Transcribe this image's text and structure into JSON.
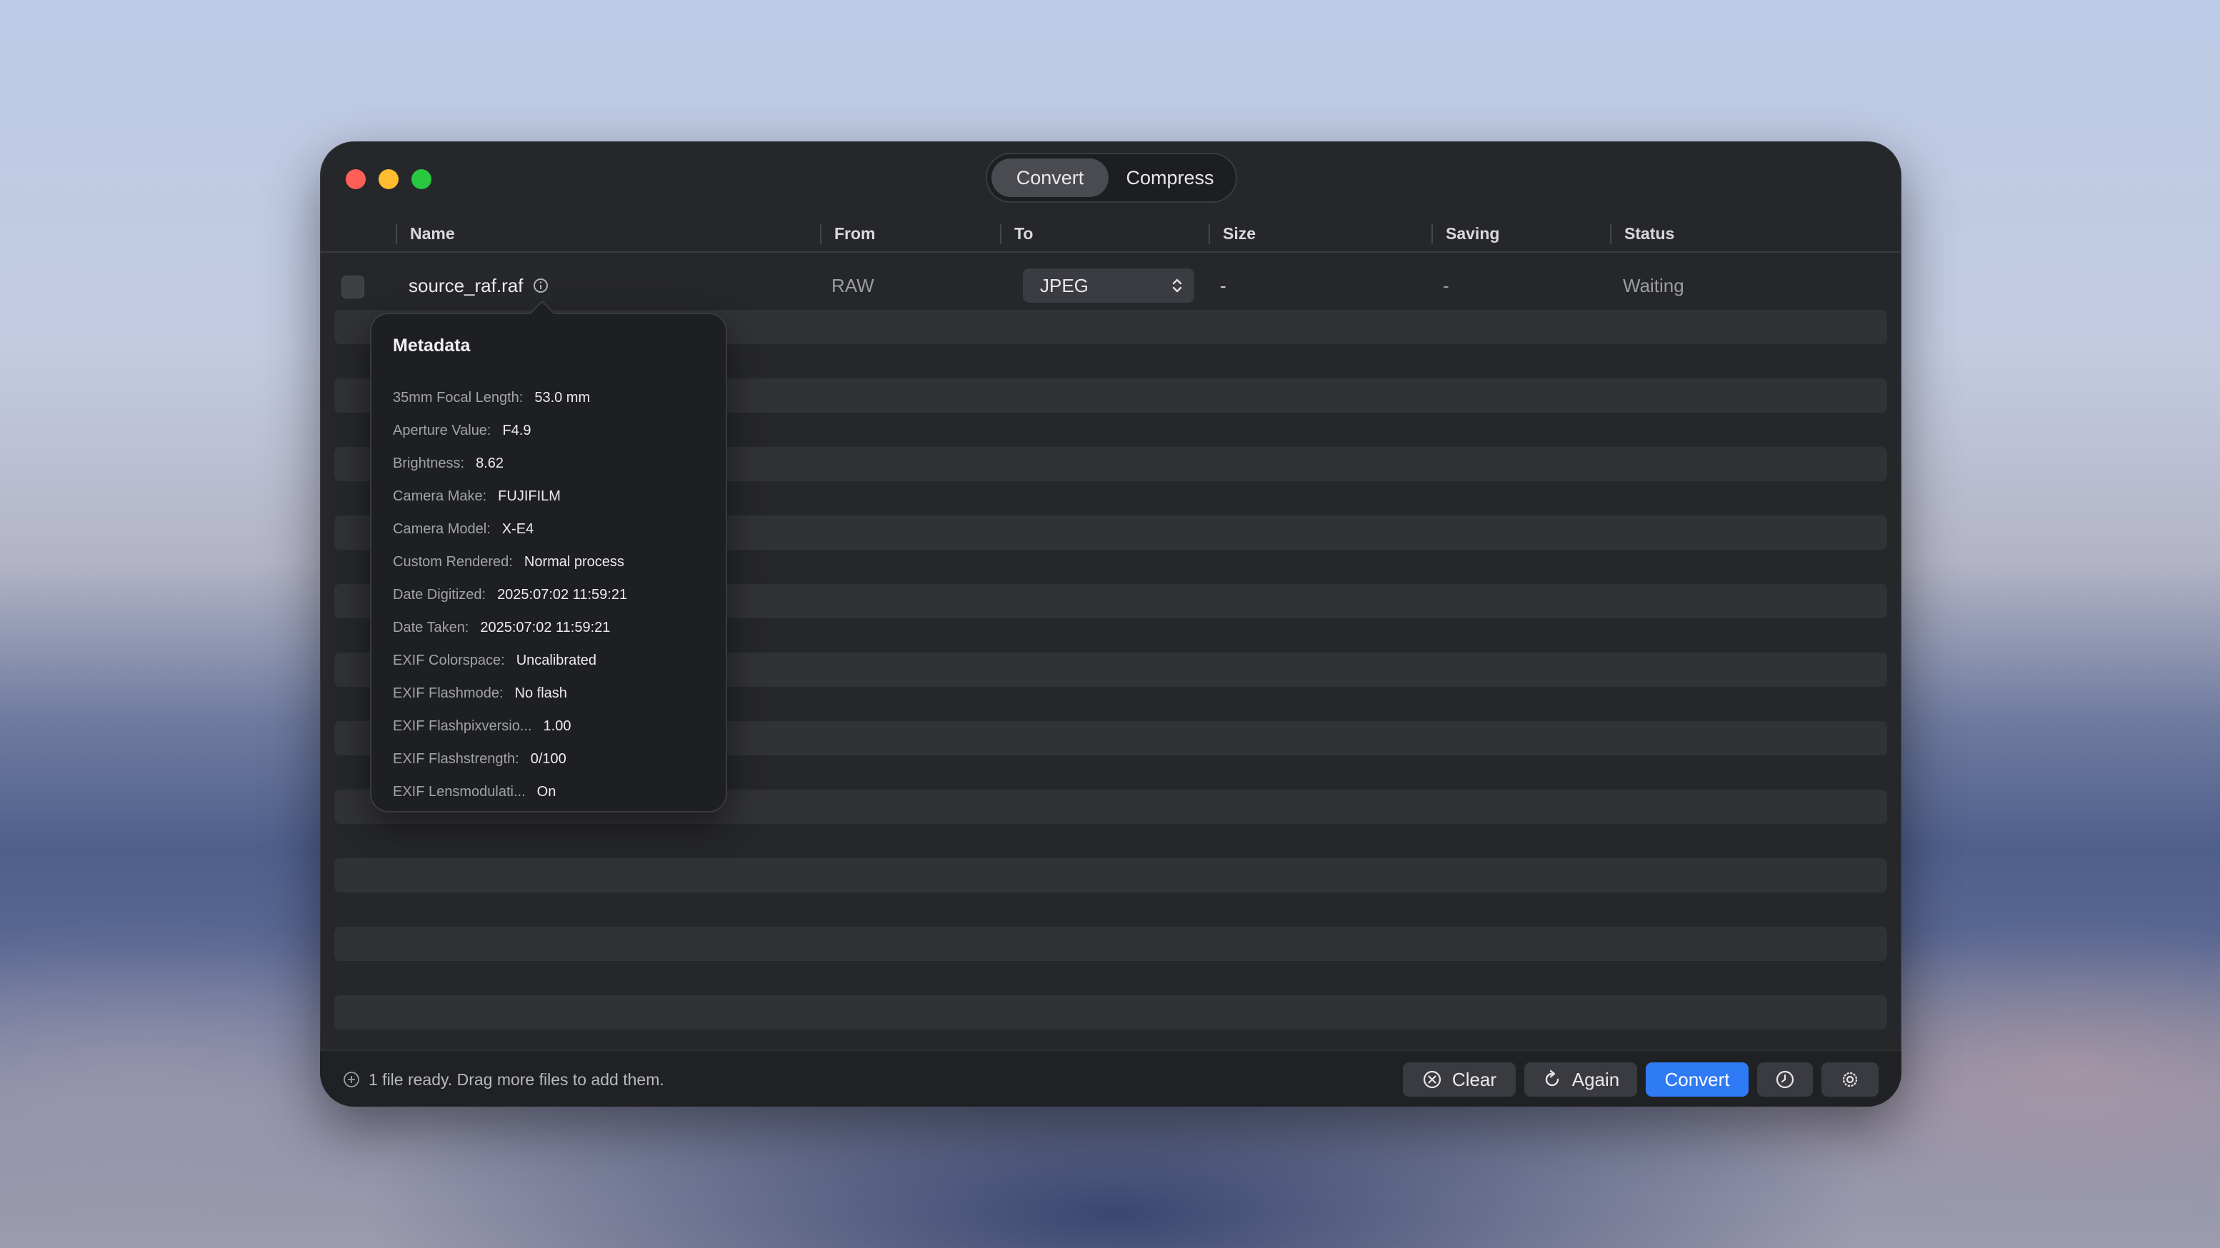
{
  "tabs": [
    {
      "label": "Convert",
      "active": true
    },
    {
      "label": "Compress",
      "active": false
    }
  ],
  "columns": {
    "name": "Name",
    "from": "From",
    "to": "To",
    "size": "Size",
    "saving": "Saving",
    "status": "Status"
  },
  "file": {
    "name": "source_raf.raf",
    "from": "RAW",
    "to": "JPEG",
    "size": "-",
    "saving": "-",
    "status": "Waiting"
  },
  "metadata": {
    "title": "Metadata",
    "rows": [
      {
        "label": "35mm Focal Length:",
        "value": "53.0 mm"
      },
      {
        "label": "Aperture Value:",
        "value": "F4.9"
      },
      {
        "label": "Brightness:",
        "value": "8.62"
      },
      {
        "label": "Camera Make:",
        "value": "FUJIFILM"
      },
      {
        "label": "Camera Model:",
        "value": "X-E4"
      },
      {
        "label": "Custom Rendered:",
        "value": "Normal process"
      },
      {
        "label": "Date Digitized:",
        "value": "2025:07:02 11:59:21"
      },
      {
        "label": "Date Taken:",
        "value": "2025:07:02 11:59:21"
      },
      {
        "label": "EXIF Colorspace:",
        "value": "Uncalibrated"
      },
      {
        "label": "EXIF Flashmode:",
        "value": "No flash"
      },
      {
        "label": "EXIF Flashpixversio...",
        "value": "1.00"
      },
      {
        "label": "EXIF Flashstrength:",
        "value": "0/100"
      },
      {
        "label": "EXIF Lensmodulati...",
        "value": "On"
      }
    ]
  },
  "footer": {
    "status": "1 file ready. Drag more files to add them.",
    "clear_label": "Clear",
    "again_label": "Again",
    "convert_label": "Convert"
  },
  "icons": {
    "clear": "x-circle-icon",
    "again": "refresh-icon",
    "history": "clock-icon",
    "settings": "gear-icon",
    "info": "info-icon",
    "status": "plus-circle-icon"
  },
  "colors": {
    "accent": "#2f7af5",
    "window": "#26272b",
    "close": "#ff5f57",
    "minimize": "#febc2e",
    "zoom": "#28c840"
  }
}
